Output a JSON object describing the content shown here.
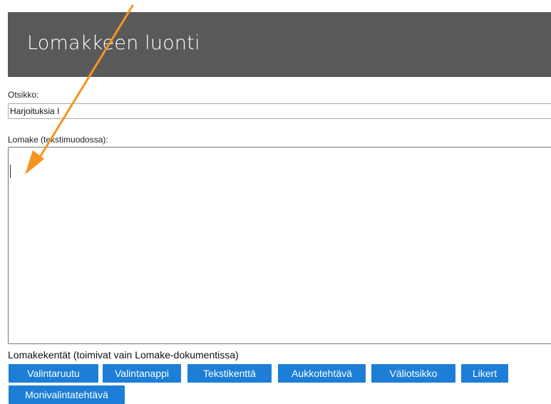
{
  "header": {
    "title": "Lomakkeen luonti"
  },
  "title_field": {
    "label": "Otsikko:",
    "value": "Harjoituksia I"
  },
  "form_field": {
    "label": "Lomake (tekstimuodossa):",
    "value": ""
  },
  "fields": {
    "label": "Lomakekentät (toimivat vain Lomake-dokumentissa)",
    "buttons": [
      "Valintaruutu",
      "Valintanappi",
      "Tekstikenttä",
      "Aukkotehtävä",
      "Väliotsikko",
      "Likert",
      "Monivalintatehtävä"
    ]
  },
  "colors": {
    "header_bg": "#595959",
    "button_bg": "#1c7ed6",
    "arrow": "#f7941d"
  },
  "overlay": {
    "icon": "arrow-annotation"
  }
}
